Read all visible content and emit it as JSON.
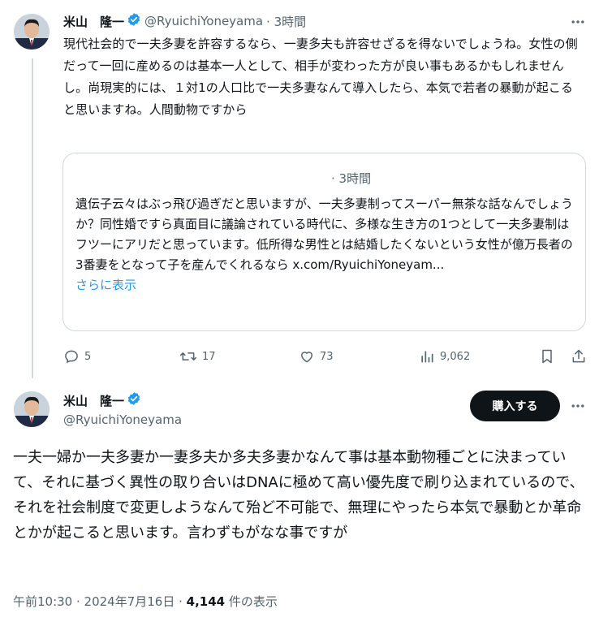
{
  "post1": {
    "display_name": "米山　隆一",
    "handle": "@RyuichiYoneyama",
    "time": "· 3時間",
    "text": "現代社会的で一夫多妻を許容するなら、一妻多夫も許容せざるを得ないでしょうね。女性の側だって一回に産めるのは基本一人として、相手が変わった方が良い事もあるかもしれませんし。尚現実的には、１対1の人口比で一夫多妻なんて導入したら、本気で若者の暴動が起こると思いますね。人間動物ですから",
    "quote": {
      "time": "· 3時間",
      "text": "遺伝子云々はぶっ飛び過ぎだと思いますが、一夫多妻制ってスーパー無茶な話なんでしょうか？同性婚ですら真面目に議論されている時代に、多様な生き方の1つとして一夫多妻制はフツーにアリだと思っています。低所得な男性とは結婚したくないという女性が億万長者の3番妻をとなって子を産んでくれるなら x.com/RyuichiYoneyam...",
      "show_more": "さらに表示"
    },
    "actions": {
      "replies": "5",
      "reposts": "17",
      "likes": "73",
      "views": "9,062"
    }
  },
  "post2": {
    "display_name": "米山　隆一",
    "handle": "@RyuichiYoneyama",
    "buy_label": "購入する",
    "text": "一夫一婦か一夫多妻か一妻多夫か多夫多妻かなんて事は基本動物種ごとに決まっていて、それに基づく異性の取り合いはDNAに極めて高い優先度で刷り込まれているので、それを社会制度で変更しようなんて殆ど不可能で、無理にやったら本気で暴動とか革命とかが起こると思います。言わずもがなな事ですが",
    "time": "午前10:30 · 2024年7月16日 · ",
    "view_count": "4,144",
    "view_suffix": " 件の表示"
  },
  "colors": {
    "accent": "#1d9bf0",
    "text": "#0f1419",
    "muted": "#536471",
    "border": "#cfd9de"
  },
  "icons": [
    "verified-badge-icon",
    "more-icon",
    "reply-icon",
    "repost-icon",
    "like-icon",
    "views-icon",
    "bookmark-icon",
    "share-icon"
  ]
}
